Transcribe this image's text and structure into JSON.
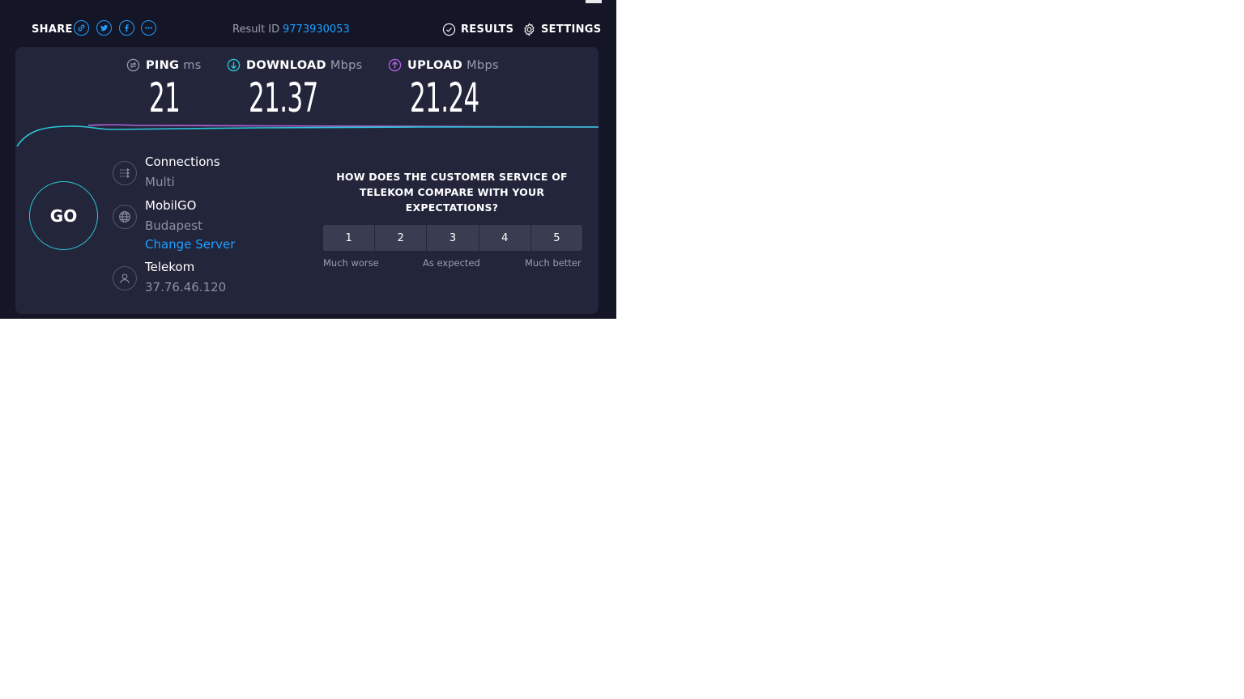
{
  "share": {
    "label": "SHARE",
    "icons": [
      "link-icon",
      "twitter-icon",
      "facebook-icon",
      "more-icon"
    ]
  },
  "result": {
    "label": "Result ID",
    "id": "9773930053"
  },
  "nav": {
    "results_label": "RESULTS",
    "settings_label": "SETTINGS"
  },
  "metrics": {
    "ping": {
      "label": "PING",
      "unit": "ms",
      "value": "21"
    },
    "download": {
      "label": "DOWNLOAD",
      "unit": "Mbps",
      "value": "21.37"
    },
    "upload": {
      "label": "UPLOAD",
      "unit": "Mbps",
      "value": "21.24"
    }
  },
  "colors": {
    "accent_blue": "#1ea0ff",
    "download_line": "#2ac8d6",
    "upload_line": "#b263e0",
    "background": "#141526",
    "panel": "#23253b"
  },
  "go_button": {
    "label": "GO"
  },
  "connections": {
    "title": "Connections",
    "value": "Multi"
  },
  "server": {
    "name": "MobilGO",
    "location": "Budapest",
    "change_label": "Change Server"
  },
  "provider": {
    "name": "Telekom",
    "ip": "37.76.46.120"
  },
  "survey": {
    "question": "HOW DOES THE CUSTOMER SERVICE OF TELEKOM COMPARE WITH YOUR EXPECTATIONS?",
    "options": [
      "1",
      "2",
      "3",
      "4",
      "5"
    ],
    "scale_low": "Much worse",
    "scale_mid": "As expected",
    "scale_high": "Much better"
  }
}
